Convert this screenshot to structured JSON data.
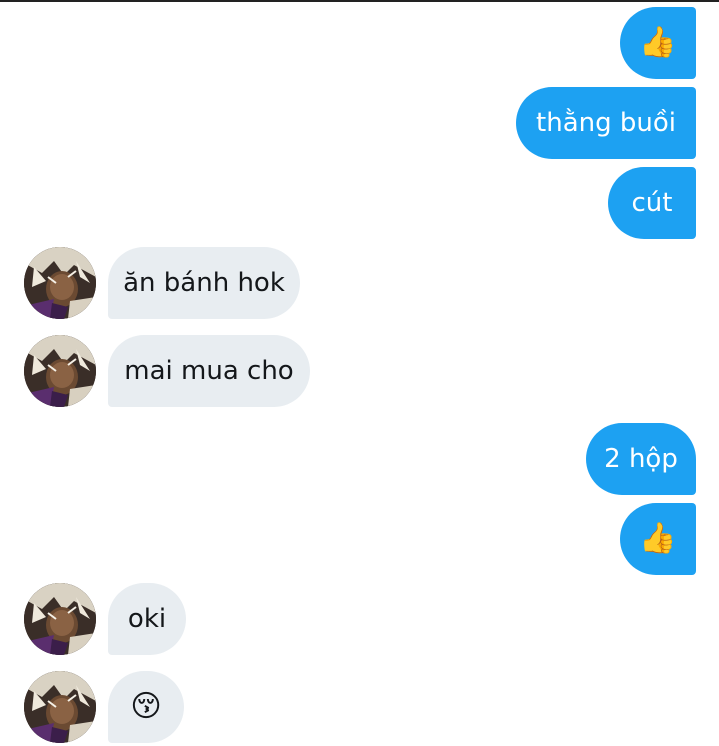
{
  "messages": [
    {
      "id": 1,
      "direction": "outgoing",
      "text": "👍",
      "is_emoji": true
    },
    {
      "id": 2,
      "direction": "outgoing",
      "text": "thằng buồi",
      "is_emoji": false
    },
    {
      "id": 3,
      "direction": "outgoing",
      "text": "cút",
      "is_emoji": false
    },
    {
      "id": 4,
      "direction": "incoming",
      "text": "ăn bánh hok",
      "is_emoji": false
    },
    {
      "id": 5,
      "direction": "incoming",
      "text": "mai mua cho",
      "is_emoji": false
    },
    {
      "id": 6,
      "direction": "outgoing",
      "text": "2 hộp",
      "is_emoji": false
    },
    {
      "id": 7,
      "direction": "outgoing",
      "text": "👍",
      "is_emoji": true
    },
    {
      "id": 8,
      "direction": "incoming",
      "text": "oki",
      "is_emoji": false
    },
    {
      "id": 9,
      "direction": "incoming",
      "text": "😚",
      "is_emoji": true
    }
  ],
  "colors": {
    "outgoing_bubble": "#1da1f2",
    "incoming_bubble": "#e8edf1",
    "outgoing_text": "#ffffff",
    "incoming_text": "#14171a"
  },
  "icons": {
    "avatar": "anime-character-avatar-icon"
  }
}
